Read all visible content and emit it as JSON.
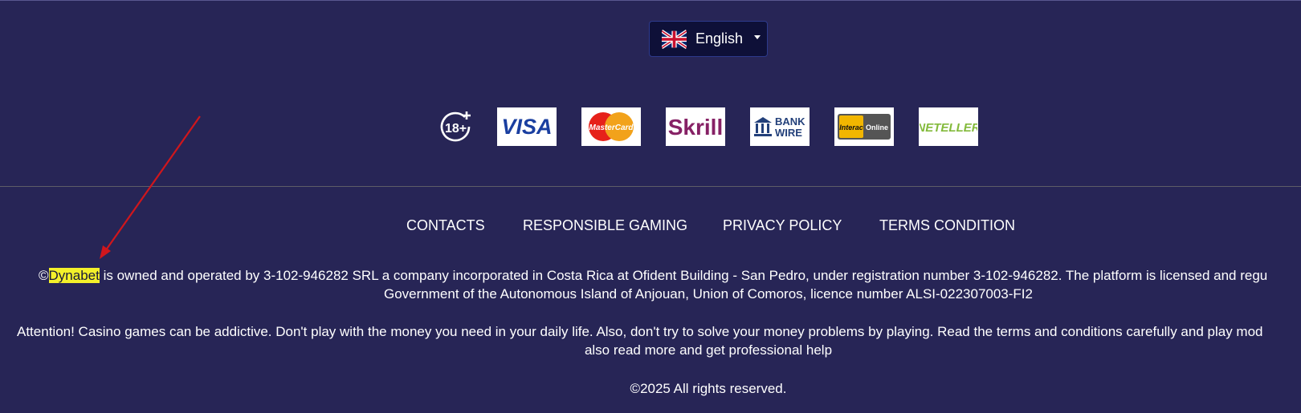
{
  "language": {
    "current": "English",
    "flag": "uk-flag-icon"
  },
  "badges": {
    "age_restriction": "18+"
  },
  "payment_methods": [
    {
      "name": "VISA",
      "icon": "visa-logo"
    },
    {
      "name": "MasterCard",
      "icon": "mastercard-logo"
    },
    {
      "name": "Skrill",
      "icon": "skrill-logo"
    },
    {
      "name": "BANK WIRE",
      "icon": "bank-wire-logo",
      "line1": "BANK",
      "line2": "WIRE"
    },
    {
      "name": "Interac Online",
      "icon": "interac-logo",
      "left": "Interac",
      "right": "Online"
    },
    {
      "name": "NETELLER",
      "icon": "neteller-logo"
    }
  ],
  "footer_nav": [
    {
      "label": "CONTACTS"
    },
    {
      "label": "RESPONSIBLE GAMING"
    },
    {
      "label": "PRIVACY POLICY"
    },
    {
      "label": "TERMS CONDITION"
    }
  ],
  "legal": {
    "copyright_symbol": "©",
    "brand": "Dynabet",
    "ownership_line1": " is owned and operated by 3-102-946282 SRL a company incorporated in Costa Rica at Ofident Building - San Pedro, under registration number 3-102-946282. The platform is licensed and regu",
    "ownership_line2": "Government of the Autonomous Island of Anjouan, Union of Comoros, licence number ALSI-022307003-FI2",
    "attention_line1": "Attention! Casino games can be addictive. Don't play with the money you need in your daily life. Also, don't try to solve your money problems by playing. Read the terms and conditions carefully and play mod",
    "attention_line2": "also read more and get professional help",
    "rights": "©2025 All rights reserved."
  },
  "colors": {
    "background": "#272556",
    "highlight": "#f3f02a",
    "annotation_arrow": "#d0161c",
    "language_button": "#0e1038"
  }
}
